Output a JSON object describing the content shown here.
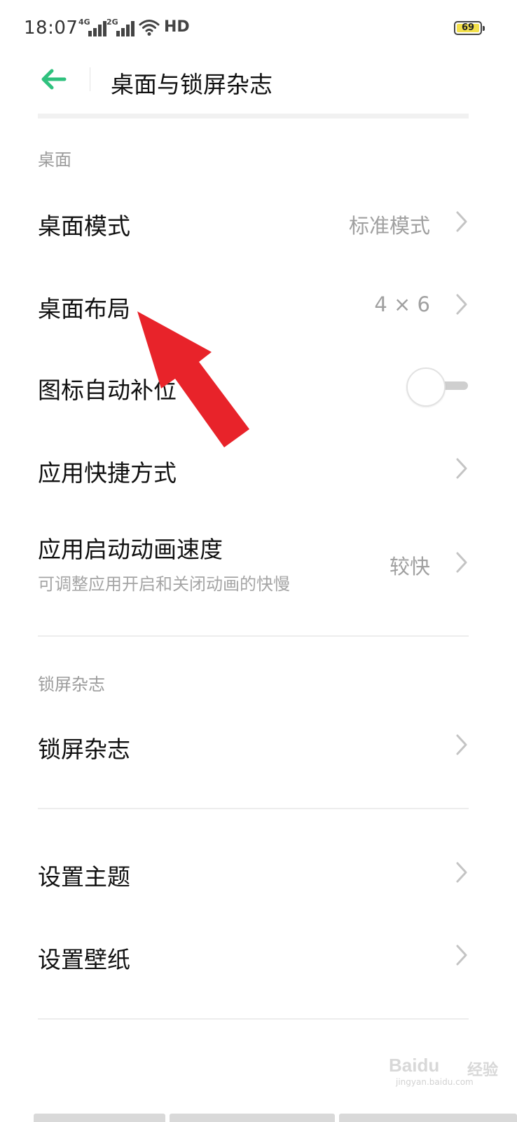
{
  "status_bar": {
    "time": "18:07",
    "signal1_label": "4G",
    "signal2_label": "2G",
    "hd_label": "HD",
    "battery_level": "69",
    "wifi_icon": "wifi-icon"
  },
  "header": {
    "title": "桌面与锁屏杂志",
    "back_icon": "back-arrow-icon",
    "accent_color": "#2fc17e"
  },
  "sections": {
    "desktop_label": "桌面",
    "lockscreen_label": "锁屏杂志"
  },
  "rows": {
    "desktop_mode": {
      "label": "桌面模式",
      "value": "标准模式"
    },
    "desktop_layout": {
      "label": "桌面布局",
      "value": "4 × 6"
    },
    "icon_autofill": {
      "label": "图标自动补位",
      "toggle_on": false
    },
    "app_shortcuts": {
      "label": "应用快捷方式"
    },
    "app_anim_speed": {
      "label": "应用启动动画速度",
      "subtitle": "可调整应用开启和关闭动画的快慢",
      "value": "较快"
    },
    "lock_magazine": {
      "label": "锁屏杂志"
    },
    "set_theme": {
      "label": "设置主题"
    },
    "set_wallpaper": {
      "label": "设置壁纸"
    }
  },
  "annotation": {
    "arrow_color": "#e8232a"
  },
  "watermark": {
    "brand": "Baidu",
    "product": "经验",
    "url": "jingyan.baidu.com"
  }
}
